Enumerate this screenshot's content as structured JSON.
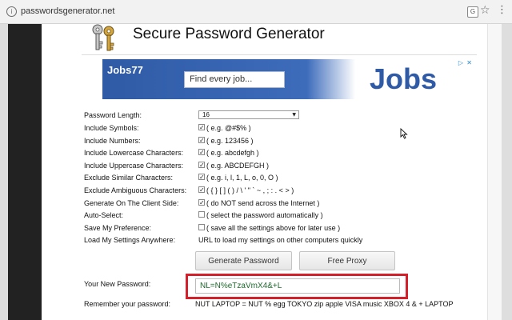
{
  "browser": {
    "url": "passwordsgenerator.net",
    "info_glyph": "i",
    "translate_glyph": "G",
    "star_glyph": "☆",
    "menu_glyph": "⋮"
  },
  "header": {
    "title": "Secure Password Generator",
    "logo_icon": "keys-icon"
  },
  "ad": {
    "brand": "Jobs77",
    "search_placeholder": "Find every job...",
    "big_text": "Jobs",
    "choices_glyph": "▷",
    "close_glyph": "✕"
  },
  "form": {
    "password_length": {
      "label": "Password Length:",
      "value": "16",
      "arrow_glyph": "▼"
    },
    "rows": [
      {
        "label": "Include Symbols:",
        "checked": true,
        "text": "( e.g. @#$% )"
      },
      {
        "label": "Include Numbers:",
        "checked": true,
        "text": "( e.g. 123456 )"
      },
      {
        "label": "Include Lowercase Characters:",
        "checked": true,
        "text": "( e.g. abcdefgh )"
      },
      {
        "label": "Include Uppercase Characters:",
        "checked": true,
        "text": "( e.g. ABCDEFGH )"
      },
      {
        "label": "Exclude Similar Characters:",
        "checked": true,
        "text": "( e.g. i, l, 1, L, o, 0, O )"
      },
      {
        "label": "Exclude Ambiguous Characters:",
        "checked": true,
        "text": "( { } [ ] ( ) / \\ ' \" ` ~ , ; : . < > )"
      },
      {
        "label": "Generate On The Client Side:",
        "checked": true,
        "text": "( do NOT send across the Internet )"
      },
      {
        "label": "Auto-Select:",
        "checked": false,
        "text": "( select the password automatically )"
      },
      {
        "label": "Save My Preference:",
        "checked": false,
        "text": "( save all the settings above for later use )"
      }
    ],
    "load_settings": {
      "label": "Load My Settings Anywhere:",
      "text": "URL to load my settings on other computers quickly"
    },
    "check_glyph": "✓"
  },
  "buttons": {
    "generate": "Generate Password",
    "proxy": "Free Proxy"
  },
  "result": {
    "new_password_label": "Your New Password:",
    "new_password_value": "NL=N%eTzaVmX4&+L",
    "remember_label": "Remember your password:",
    "remember_value": "NUT LAPTOP = NUT % egg TOKYO zip apple VISA music XBOX 4 & + LAPTOP"
  }
}
